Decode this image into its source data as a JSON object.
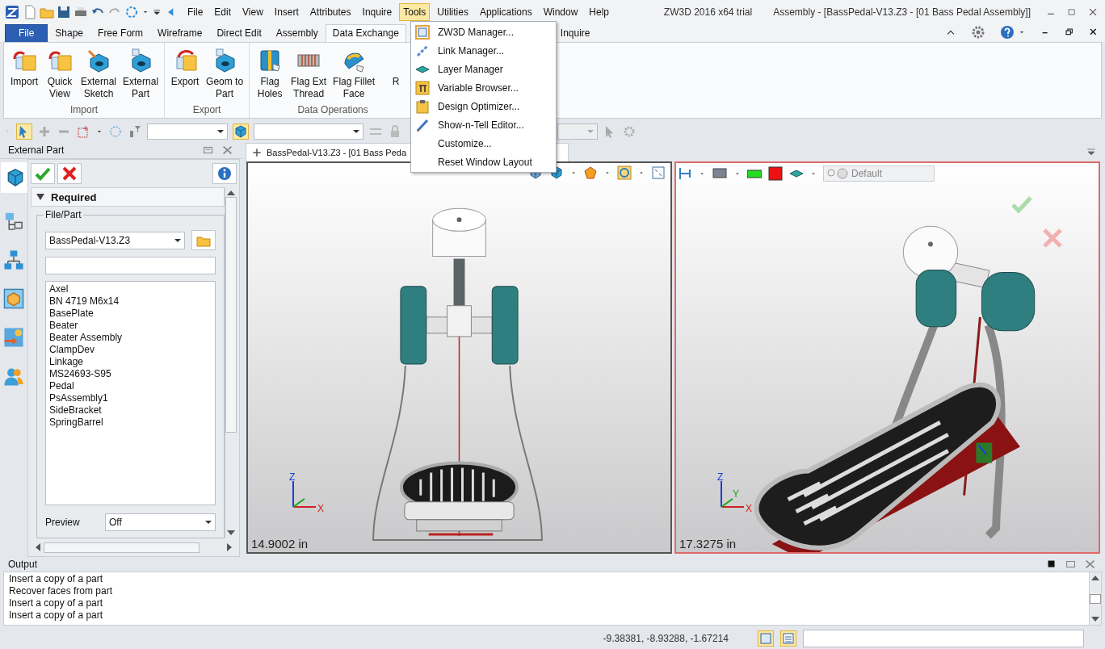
{
  "title": {
    "app": "ZW3D 2016  x64 trial",
    "document": "Assembly - [BassPedal-V13.Z3 - [01 Bass Pedal Assembly]]"
  },
  "menu_bar": {
    "items": [
      {
        "label": "File",
        "selected": false
      },
      {
        "label": "Edit",
        "selected": false
      },
      {
        "label": "View",
        "selected": false
      },
      {
        "label": "Insert",
        "selected": false
      },
      {
        "label": "Attributes",
        "selected": false
      },
      {
        "label": "Inquire",
        "selected": false
      },
      {
        "label": "Tools",
        "selected": true
      },
      {
        "label": "Utilities",
        "selected": false
      },
      {
        "label": "Applications",
        "selected": false
      },
      {
        "label": "Window",
        "selected": false
      },
      {
        "label": "Help",
        "selected": false
      }
    ]
  },
  "ribbon_tabs": [
    {
      "label": "File",
      "kind": "file",
      "selected": false
    },
    {
      "label": "Shape",
      "kind": "tab",
      "selected": false
    },
    {
      "label": "Free Form",
      "kind": "tab",
      "selected": false
    },
    {
      "label": "Wireframe",
      "kind": "tab",
      "selected": false
    },
    {
      "label": "Direct Edit",
      "kind": "tab",
      "selected": false
    },
    {
      "label": "Assembly",
      "kind": "tab",
      "selected": false
    },
    {
      "label": "Data Exchange",
      "kind": "tab",
      "selected": true
    },
    {
      "label": "Inquire",
      "kind": "tab",
      "selected": false
    }
  ],
  "ribbon_groups": [
    {
      "label": "Import",
      "buttons": [
        "Import",
        "Quick\nView",
        "External\nSketch",
        "External\nPart"
      ]
    },
    {
      "label": "Export",
      "buttons": [
        "Export",
        "Geom to\nPart"
      ]
    },
    {
      "label": "Data Operations",
      "buttons": [
        "Flag\nHoles",
        "Flag Ext\nThread",
        "Flag Fillet\nFace",
        "R"
      ]
    }
  ],
  "tools_menu": {
    "items": [
      "ZW3D Manager...",
      "Link Manager...",
      "Layer Manager",
      "Variable Browser...",
      "Design Optimizer...",
      "Show-n-Tell Editor...",
      "Customize...",
      "Reset Window Layout"
    ]
  },
  "panel": {
    "title": "External Part",
    "section": {
      "label": "Required",
      "expanded": true
    },
    "group": "File/Part",
    "file": "BassPedal-V13.Z3",
    "parts": [
      "Axel",
      "BN 4719 M6x14",
      "BasePlate",
      "Beater",
      "Beater Assembly",
      "ClampDev",
      "Linkage",
      "MS24693-S95",
      "Pedal",
      "PsAssembly1",
      "SideBracket",
      "SpringBarrel"
    ],
    "preview_label": "Preview",
    "preview_value": "Off"
  },
  "document_tab": "BassPedal-V13.Z3 - [01 Bass Peda",
  "view_style": {
    "value": "Default",
    "disabled": true
  },
  "viewports": [
    {
      "kind": "front",
      "scale": "14.9002 in",
      "active": false,
      "axes": [
        "Z",
        "X"
      ]
    },
    {
      "kind": "iso",
      "scale": "17.3275 in",
      "active": true,
      "axes": [
        "Z",
        "Y",
        "X"
      ]
    }
  ],
  "output": {
    "title": "Output",
    "lines": [
      "Insert a copy of a part",
      "Recover faces from part",
      "Insert a copy of a part",
      "Insert a copy of a part"
    ]
  },
  "status_bar": {
    "coordinates": "-9.38381, -8.93288, -1.67214"
  }
}
